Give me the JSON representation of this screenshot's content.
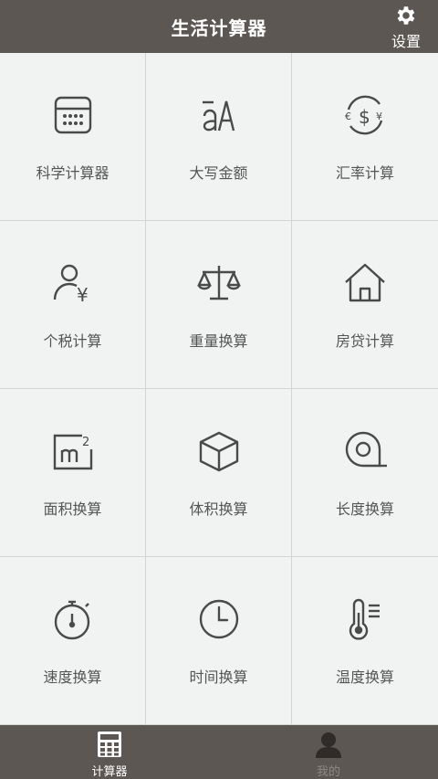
{
  "header": {
    "title": "生活计算器",
    "settings_label": "设置"
  },
  "tools": [
    {
      "label": "科学计算器",
      "icon": "calculator-icon"
    },
    {
      "label": "大写金额",
      "icon": "text-case-icon"
    },
    {
      "label": "汇率计算",
      "icon": "currency-exchange-icon"
    },
    {
      "label": "个税计算",
      "icon": "person-yen-icon"
    },
    {
      "label": "重量换算",
      "icon": "scale-icon"
    },
    {
      "label": "房贷计算",
      "icon": "house-icon"
    },
    {
      "label": "面积换算",
      "icon": "square-meter-icon"
    },
    {
      "label": "体积换算",
      "icon": "cube-icon"
    },
    {
      "label": "长度换算",
      "icon": "tape-measure-icon"
    },
    {
      "label": "速度换算",
      "icon": "stopwatch-icon"
    },
    {
      "label": "时间换算",
      "icon": "clock-icon"
    },
    {
      "label": "温度换算",
      "icon": "thermometer-icon"
    }
  ],
  "tabs": [
    {
      "label": "计算器",
      "active": true,
      "icon": "calculator-tab-icon"
    },
    {
      "label": "我的",
      "active": false,
      "icon": "user-tab-icon"
    }
  ],
  "colors": {
    "header_bg": "#5d5753",
    "grid_bg": "#f1f2f2",
    "icon_stroke": "#4a4a4a",
    "label_text": "#555555"
  }
}
